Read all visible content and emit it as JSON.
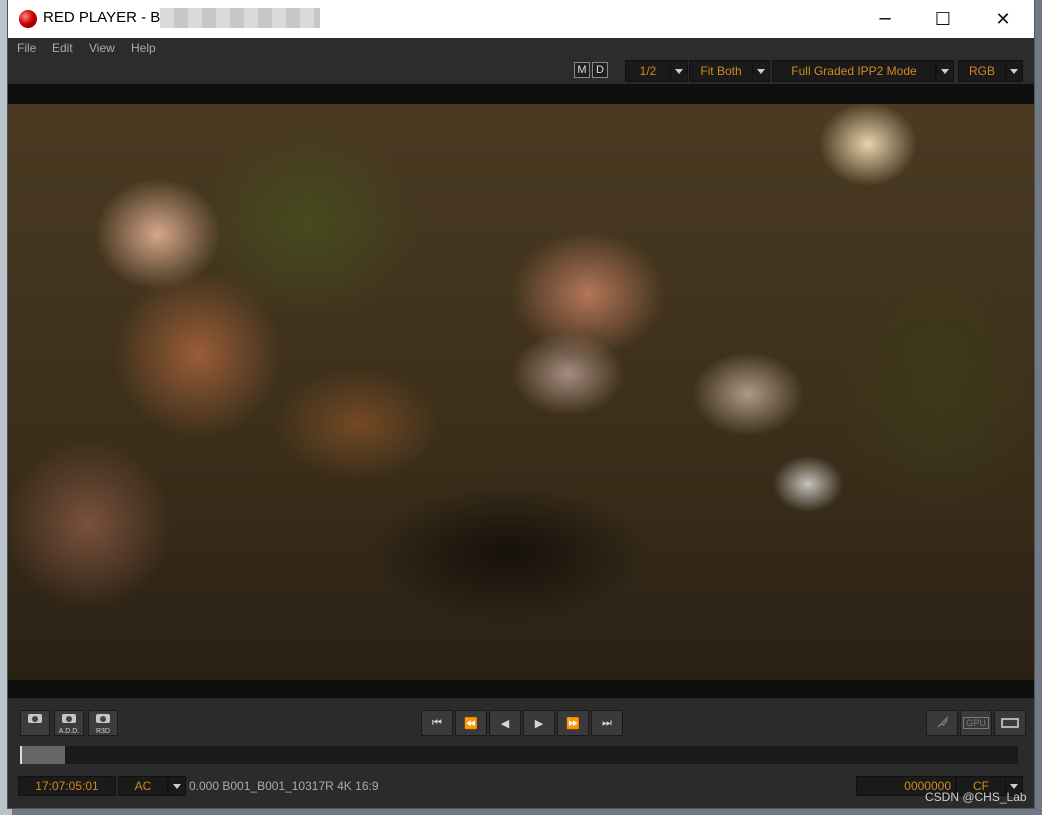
{
  "window": {
    "title": "RED PLAYER - B"
  },
  "menu": [
    "File",
    "Edit",
    "View",
    "Help"
  ],
  "toolbar": {
    "m_label": "M",
    "d_label": "D",
    "zoom": "1/2",
    "fit": "Fit Both",
    "mode": "Full Graded IPP2 Mode",
    "channel": "RGB"
  },
  "snapshots": [
    {
      "label": ""
    },
    {
      "label": "A.D.D."
    },
    {
      "label": "R3D"
    }
  ],
  "playback": {
    "first": "⏮",
    "rewind": "⏪",
    "step_back": "◀",
    "play": "▶",
    "fast_forward": "⏩",
    "last": "⏭"
  },
  "right_controls": {
    "gpu": "GPU"
  },
  "status": {
    "timecode": "17:07:05:01",
    "audio": "AC",
    "clip_info": "0.000 B001_B001_10317R 4K 16:9",
    "frame": "0000000",
    "cf": "CF"
  },
  "timeline": {
    "position": 0.0
  },
  "watermark": "CSDN @CHS_Lab",
  "colors": {
    "accent": "#d18a1e",
    "panel": "#2b2b2b"
  }
}
